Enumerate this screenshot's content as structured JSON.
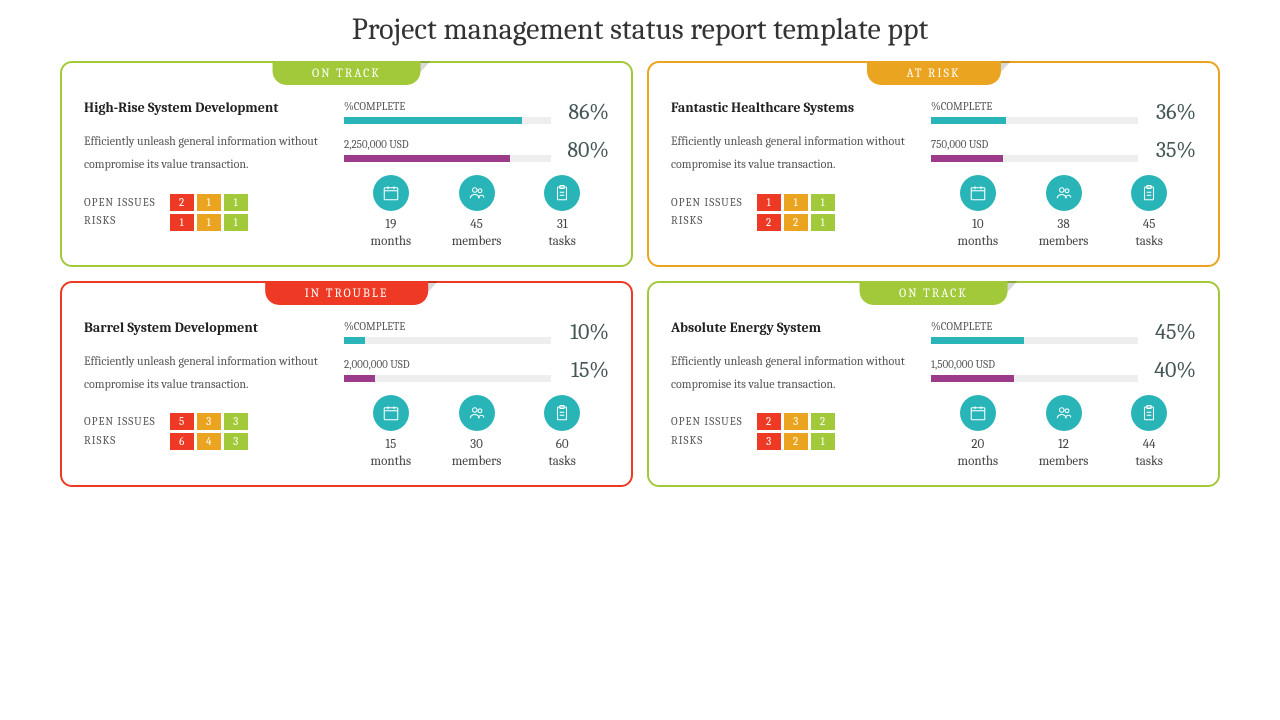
{
  "title": "Project management status report template ppt",
  "colors": {
    "green": "#a2c93a",
    "orange": "#eba41f",
    "red": "#ee3a24",
    "teal": "#29b5b8",
    "purple": "#9b3b8a"
  },
  "issues_label": "OPEN ISSUES",
  "risks_label": "RISKS",
  "complete_label": "%COMPLETE",
  "months_unit": "months",
  "members_unit": "members",
  "tasks_unit": "tasks",
  "cards": [
    {
      "status": "ON TRACK",
      "border": "#a2c93a",
      "tab": "#a2c93a",
      "project": "High-Rise System Development",
      "desc": "Efficiently unleash general information without compromise its value transaction.",
      "complete_pct": 86,
      "budget_label": "2,250,000 USD",
      "budget_pct": 80,
      "issues": [
        2,
        1,
        1
      ],
      "risks": [
        1,
        1,
        1
      ],
      "months": 19,
      "members": 45,
      "tasks": 31
    },
    {
      "status": "AT RISK",
      "border": "#eba41f",
      "tab": "#eba41f",
      "project": "Fantastic Healthcare Systems",
      "desc": "Efficiently unleash general information without compromise its value transaction.",
      "complete_pct": 36,
      "budget_label": "750,000 USD",
      "budget_pct": 35,
      "issues": [
        1,
        1,
        1
      ],
      "risks": [
        2,
        2,
        1
      ],
      "months": 10,
      "members": 38,
      "tasks": 45
    },
    {
      "status": "IN TROUBLE",
      "border": "#ee3a24",
      "tab": "#ee3a24",
      "project": "Barrel System Development",
      "desc": "Efficiently unleash general information without compromise its value transaction.",
      "complete_pct": 10,
      "budget_label": "2,000,000 USD",
      "budget_pct": 15,
      "issues": [
        5,
        3,
        3
      ],
      "risks": [
        6,
        4,
        3
      ],
      "months": 15,
      "members": 30,
      "tasks": 60
    },
    {
      "status": "ON TRACK",
      "border": "#a2c93a",
      "tab": "#a2c93a",
      "project": "Absolute Energy System",
      "desc": "Efficiently unleash general information without compromise its value transaction.",
      "complete_pct": 45,
      "budget_label": "1,500,000 USD",
      "budget_pct": 40,
      "issues": [
        2,
        3,
        2
      ],
      "risks": [
        3,
        2,
        1
      ],
      "months": 20,
      "members": 12,
      "tasks": 44
    }
  ]
}
